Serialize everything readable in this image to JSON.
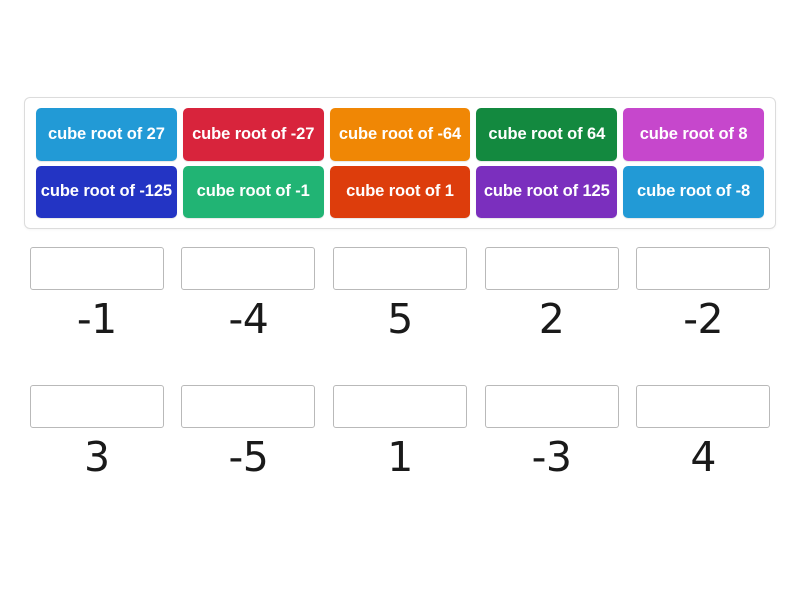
{
  "activity": {
    "type": "match-up-drag-and-drop",
    "title": ""
  },
  "tiles_tray": {
    "rows": [
      [
        {
          "label": "cube root of 27",
          "color": "#229ad6"
        },
        {
          "label": "cube root of -27",
          "color": "#d8243c"
        },
        {
          "label": "cube root of -64",
          "color": "#f08705"
        },
        {
          "label": "cube root of 64",
          "color": "#13893f"
        },
        {
          "label": "cube root of 8",
          "color": "#c647cc"
        }
      ],
      [
        {
          "label": "cube root of -125",
          "color": "#2334c4"
        },
        {
          "label": "cube root of -1",
          "color": "#21b474"
        },
        {
          "label": "cube root of 1",
          "color": "#dd3d0c"
        },
        {
          "label": "cube root of 125",
          "color": "#7b2fbe"
        },
        {
          "label": "cube root of -8",
          "color": "#229ad6"
        }
      ]
    ]
  },
  "answers": {
    "row1": [
      {
        "drop_value": "",
        "value": "-1"
      },
      {
        "drop_value": "",
        "value": "-4"
      },
      {
        "drop_value": "",
        "value": "5"
      },
      {
        "drop_value": "",
        "value": "2"
      },
      {
        "drop_value": "",
        "value": "-2"
      }
    ],
    "row2": [
      {
        "drop_value": "",
        "value": "3"
      },
      {
        "drop_value": "",
        "value": "-5"
      },
      {
        "drop_value": "",
        "value": "1"
      },
      {
        "drop_value": "",
        "value": "-3"
      },
      {
        "drop_value": "",
        "value": "4"
      }
    ]
  },
  "colors": {
    "page_background": "#ffffff",
    "tray_border": "#dcdcdc",
    "drop_zone_border": "#b9b9b9",
    "answer_text": "#1a1a1a",
    "tile_text": "#ffffff"
  }
}
